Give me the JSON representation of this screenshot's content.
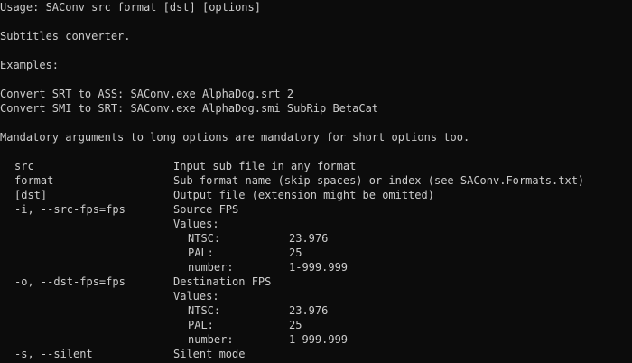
{
  "terminal": {
    "usage": "Usage: SAConv src format [dst] [options]",
    "description": "Subtitles converter.",
    "examples_header": "Examples:",
    "examples": [
      "Convert SRT to ASS: SAConv.exe AlphaDog.srt 2",
      "Convert SMI to SRT: SAConv.exe AlphaDog.smi SubRip BetaCat"
    ],
    "mandatory_note": "Mandatory arguments to long options are mandatory for short options too.",
    "options": {
      "src": {
        "name": "src",
        "desc": "Input sub file in any format"
      },
      "format": {
        "name": "format",
        "desc": "Sub format name (skip spaces) or index (see SAConv.Formats.txt)"
      },
      "dst": {
        "name": "[dst]",
        "desc": "Output file (extension might be omitted)"
      },
      "src_fps": {
        "name": "-i, --src-fps=fps",
        "desc": "Source FPS",
        "values_label": "Values:",
        "values": [
          {
            "label": "NTSC:",
            "value": "23.976"
          },
          {
            "label": "PAL:",
            "value": "25"
          },
          {
            "label": "number:",
            "value": "1-999.999"
          }
        ]
      },
      "dst_fps": {
        "name": "-o, --dst-fps=fps",
        "desc": "Destination FPS",
        "values_label": "Values:",
        "values": [
          {
            "label": "NTSC:",
            "value": "23.976"
          },
          {
            "label": "PAL:",
            "value": "25"
          },
          {
            "label": "number:",
            "value": "1-999.999"
          }
        ]
      },
      "silent": {
        "name": "-s, --silent",
        "desc": "Silent mode"
      }
    }
  }
}
